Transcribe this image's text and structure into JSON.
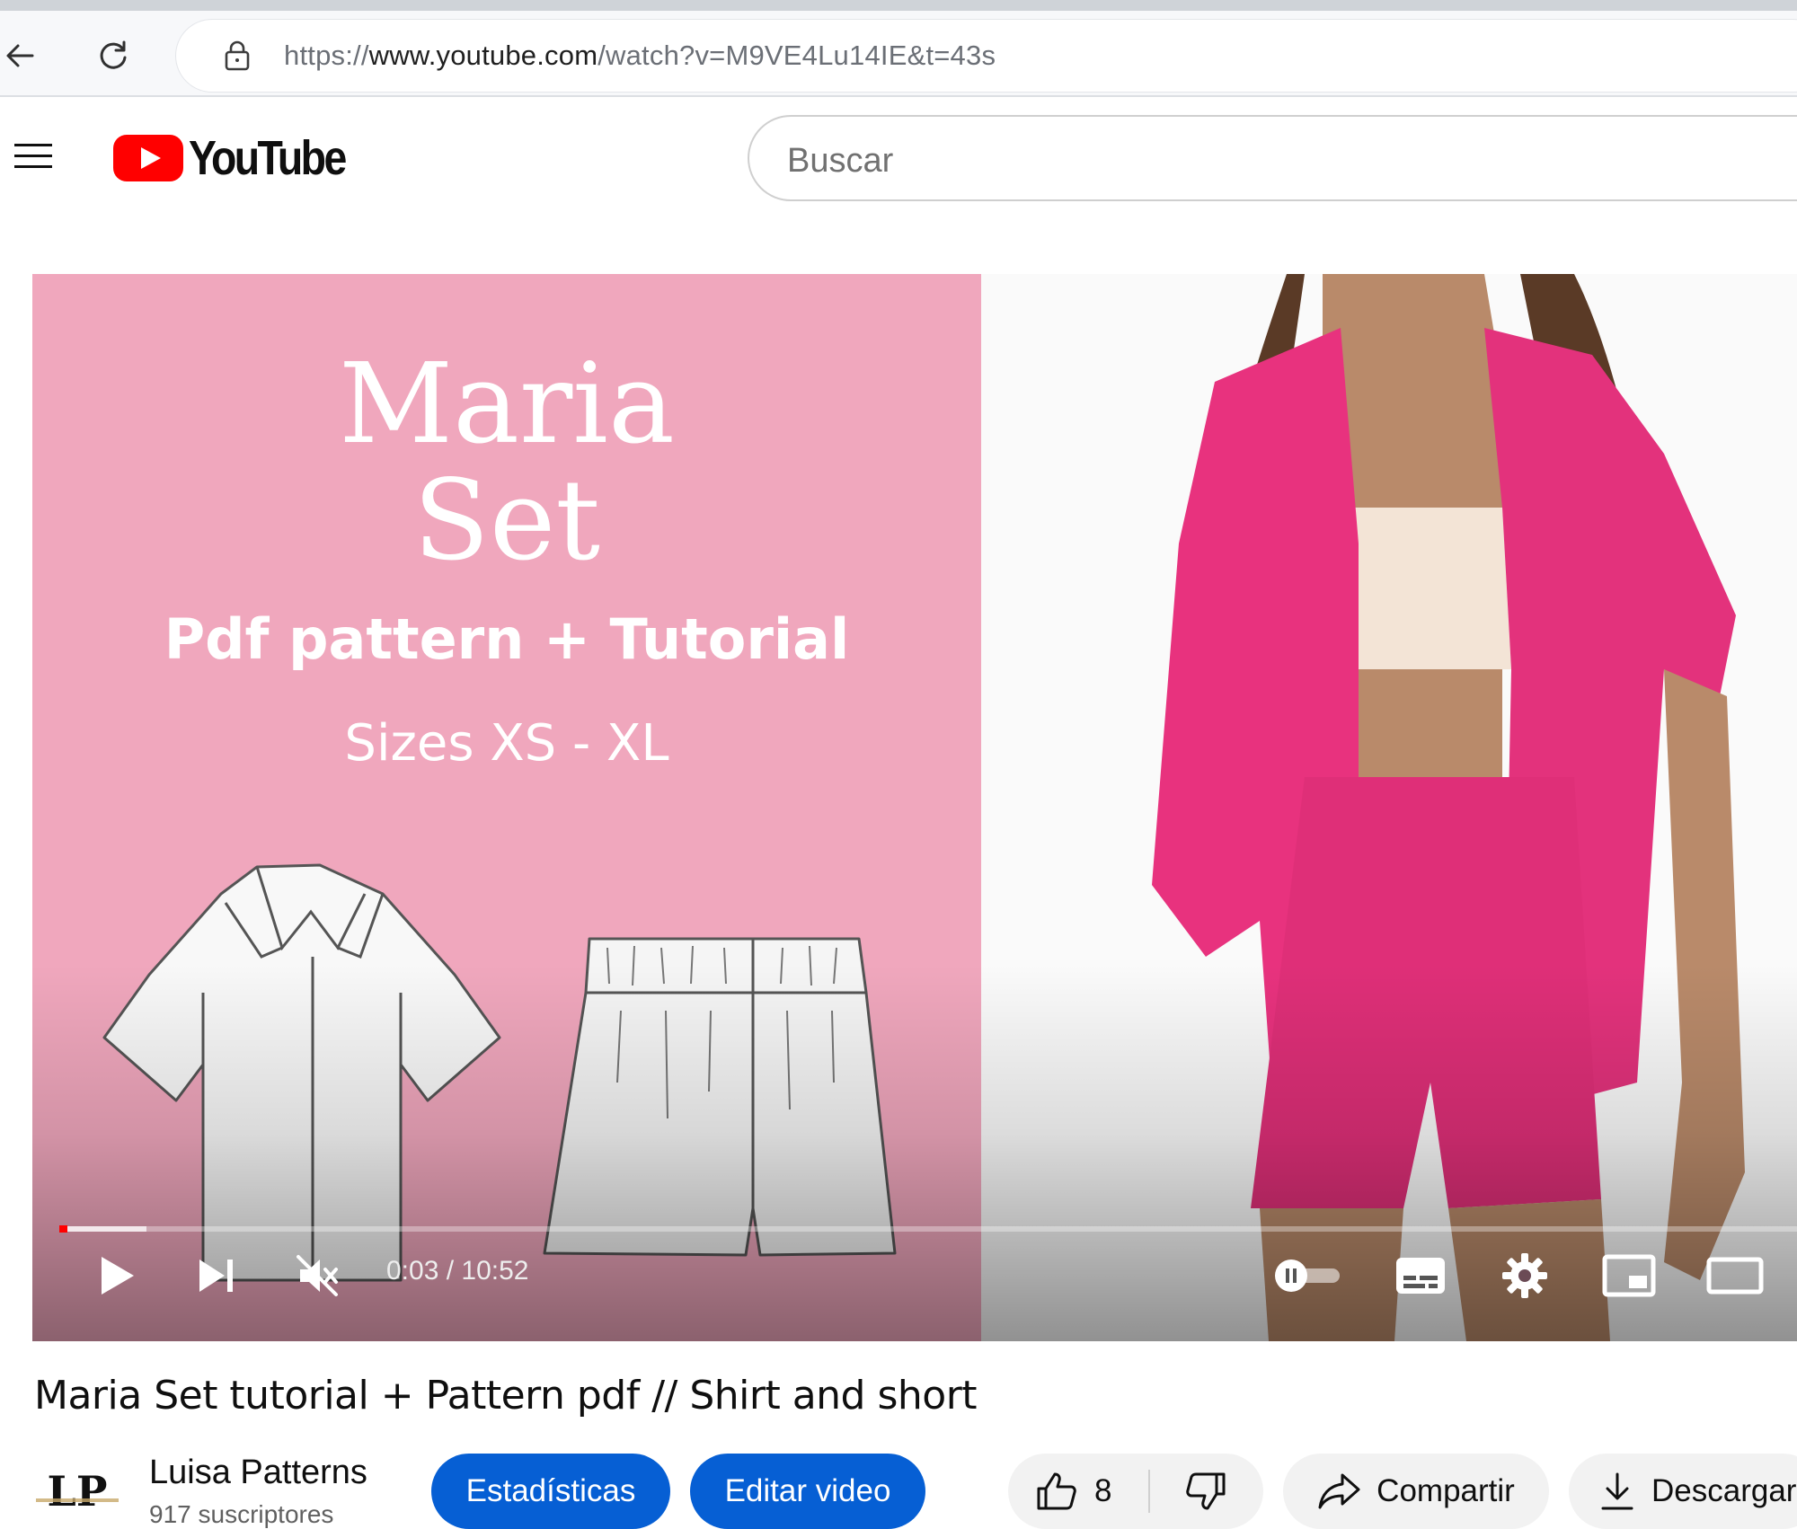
{
  "browser": {
    "url_prefix": "https://",
    "url_host": "www.youtube.com",
    "url_path": "/watch?v=M9VE4Lu14IE&t=43s"
  },
  "header": {
    "logo_text": "YouTube",
    "search_placeholder": "Buscar"
  },
  "player": {
    "thumbnail": {
      "title_line1": "Maria",
      "title_line2": "Set",
      "subtitle": "Pdf pattern + Tutorial",
      "sizes": "Sizes XS - XL"
    },
    "time_display": "0:03 / 10:52",
    "current_seconds": 3,
    "duration_seconds": 652,
    "buffered_fraction": 0.05,
    "accent_color": "#ff0000"
  },
  "video": {
    "title": "Maria Set tutorial + Pattern pdf // Shirt and short",
    "channel_name": "Luisa Patterns",
    "subscribers": "917 suscriptores",
    "stats_button": "Estadísticas",
    "edit_button": "Editar video",
    "like_count": "8",
    "share_label": "Compartir",
    "download_label": "Descargar"
  }
}
